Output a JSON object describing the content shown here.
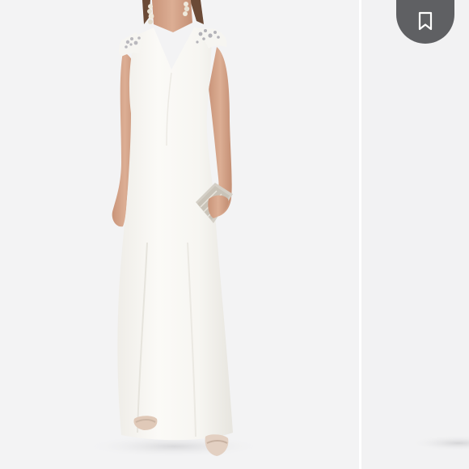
{
  "listing": {
    "photos": [
      {
        "alt": "",
        "subject": "white-evening-gown",
        "active": true
      },
      {
        "alt": "",
        "subject": "next-photo",
        "active": false
      }
    ]
  },
  "save_button": {
    "icon": "bookmark-icon",
    "color": "#5f6063",
    "icon_color": "#ffffff"
  },
  "colors": {
    "background": "#f3f3f4",
    "gown": "#f9f8f5",
    "skin": "#d8a88e"
  }
}
